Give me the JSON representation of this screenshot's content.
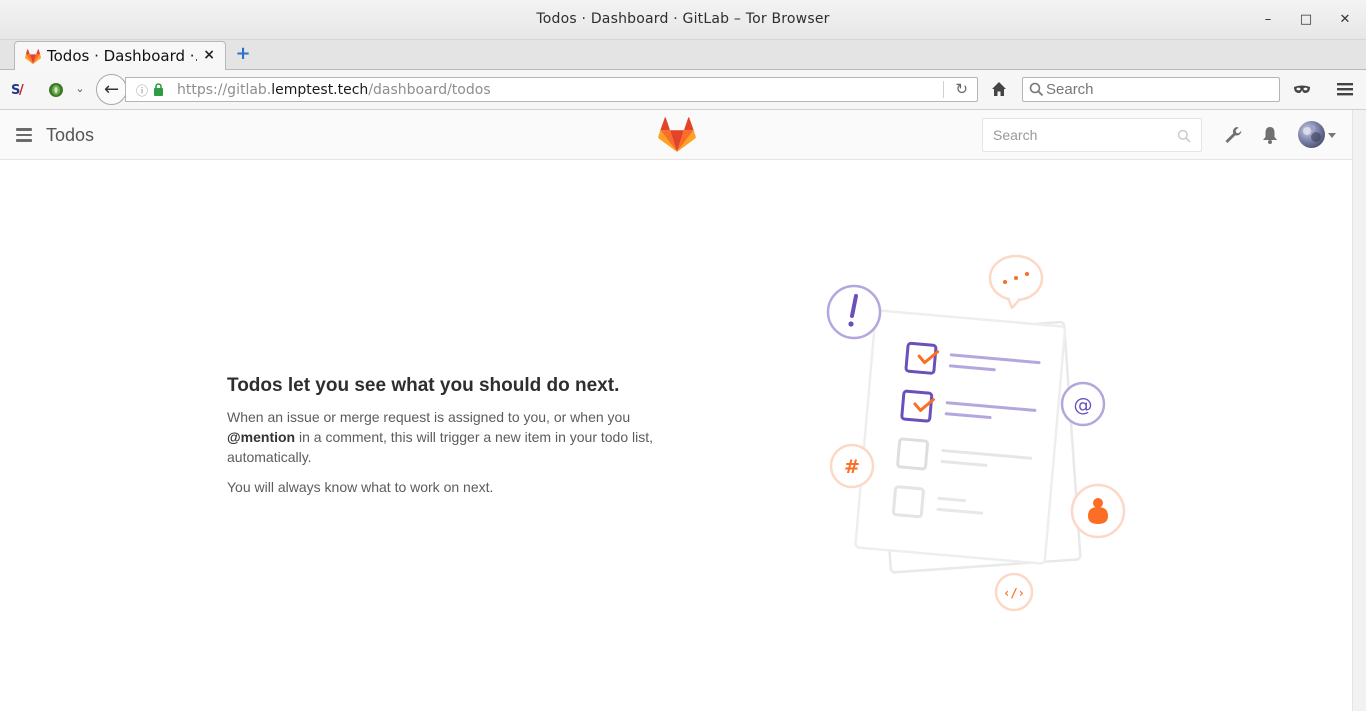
{
  "window": {
    "title": "Todos · Dashboard · GitLab – Tor Browser"
  },
  "tabs": [
    {
      "title": "Todos · Dashboard ·…",
      "close_icon": "×"
    }
  ],
  "browser": {
    "url_prefix": "https://gitlab.",
    "url_host": "lemptest.tech",
    "url_path": "/dashboard/todos",
    "search_placeholder": "Search"
  },
  "header": {
    "title": "Todos",
    "search_placeholder": "Search"
  },
  "empty_state": {
    "heading": "Todos let you see what you should do next.",
    "p1_before": "When an issue or merge request is assigned to you, or when you ",
    "p1_mention": "@mention",
    "p1_after": " in a comment, this will trigger a new item in your todo list, automatically.",
    "p2": "You will always know what to work on next."
  },
  "colors": {
    "accent_orange": "#fc6d26",
    "accent_purple": "#6b4fbb",
    "light_purple": "#b5a7dd"
  }
}
